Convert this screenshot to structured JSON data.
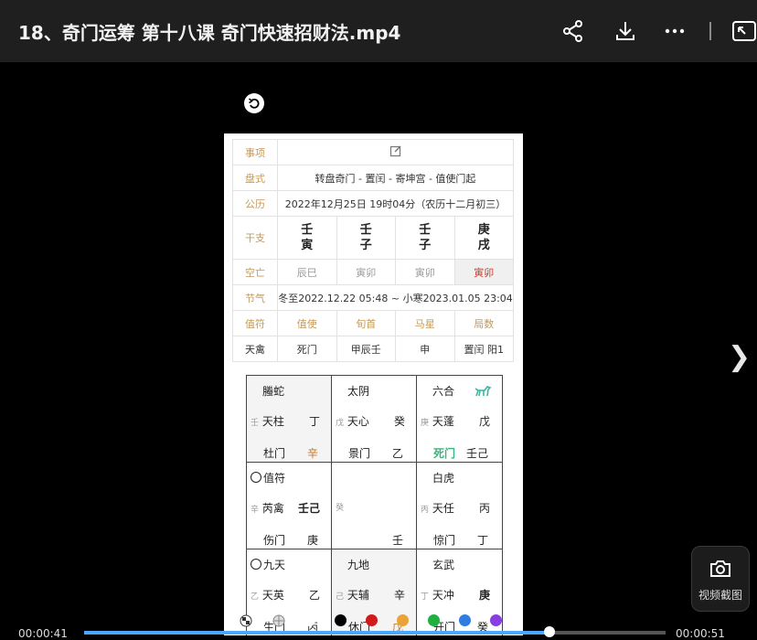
{
  "window": {
    "title": "18、奇门运筹 第十八课 奇门快速招财法.mp4"
  },
  "toolbar": {
    "share": "share-icon",
    "download": "download-icon",
    "more": "more-icon",
    "pip": "picture-in-picture-icon"
  },
  "chart": {
    "rows": {
      "shixiang_label": "事项",
      "panshi_label": "盘式",
      "panshi_value": "转盘奇门 - 置闰 - 寄坤宫 - 值使门起",
      "gongli_label": "公历",
      "gongli_value": "2022年12月25日 19时04分（农历十二月初三）",
      "ganzhi_label": "干支",
      "ganzhi": [
        [
          "壬",
          "寅"
        ],
        [
          "壬",
          "子"
        ],
        [
          "壬",
          "子"
        ],
        [
          "庚",
          "戌"
        ]
      ],
      "kongwang_label": "空亡",
      "kongwang": [
        "辰巳",
        "寅卯",
        "寅卯",
        "寅卯"
      ],
      "jieqi_label": "节气",
      "jieqi_value": "冬至2022.12.22 05:48 ~ 小寒2023.01.05 23:04",
      "heads": [
        "值符",
        "值使",
        "旬首",
        "马星",
        "局数"
      ],
      "vals": [
        "天禽",
        "死门",
        "甲辰壬",
        "申",
        "置闰 阳1"
      ]
    },
    "palaces": [
      {
        "god": "螣蛇",
        "stem_small": "壬",
        "star": "天柱",
        "stem_big": "丁",
        "door": "杜门",
        "door_stem": "辛"
      },
      {
        "god": "太阴",
        "stem_small": "戊",
        "star": "天心",
        "stem_big": "癸",
        "door": "景门",
        "door_stem": "乙"
      },
      {
        "god": "六合",
        "stem_small": "庚",
        "star": "天蓬",
        "stem_big": "戊",
        "door": "死门",
        "door_stem": "壬己"
      },
      {
        "god": "值符",
        "stem_small": "辛",
        "star": "芮禽",
        "stem_big": "壬己",
        "door": "伤门",
        "door_stem": "庚"
      },
      {
        "god": "",
        "stem_small": "癸",
        "star": "",
        "stem_big": "",
        "door": "",
        "door_stem": "壬"
      },
      {
        "god": "白虎",
        "stem_small": "丙",
        "star": "天任",
        "stem_big": "丙",
        "door": "惊门",
        "door_stem": "丁"
      },
      {
        "god": "九天",
        "stem_small": "乙",
        "star": "天英",
        "stem_big": "乙",
        "door": "生门",
        "door_stem": "丙"
      },
      {
        "god": "九地",
        "stem_small": "己",
        "star": "天辅",
        "stem_big": "辛",
        "door": "休门",
        "door_stem": "戊"
      },
      {
        "god": "玄武",
        "stem_small": "丁",
        "star": "天冲",
        "stem_big": "庚",
        "door": "开门",
        "door_stem": "癸"
      }
    ]
  },
  "player": {
    "time_current": "00:00:41",
    "time_total": "00:00:51",
    "progress": 0.8,
    "snapshot_label": "视频截图",
    "colors": [
      "#ffffff",
      "#000000",
      "#d11a1a",
      "#e8a33b",
      "#20b040",
      "#2f7de0",
      "#8a3de0"
    ]
  }
}
